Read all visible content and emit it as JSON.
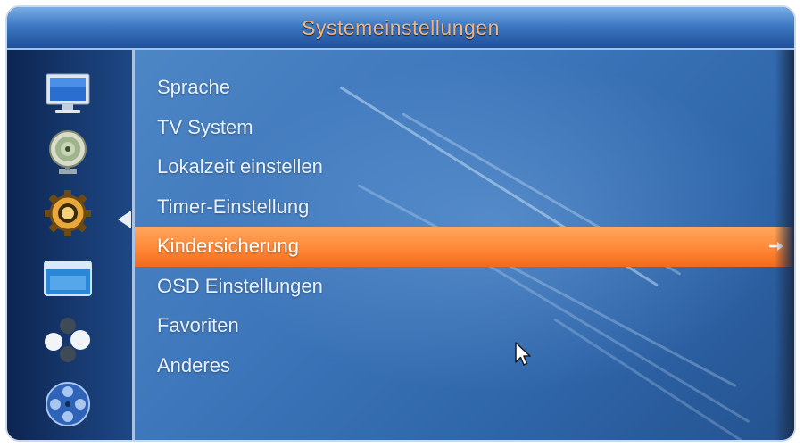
{
  "window": {
    "title": "Systemeinstellungen"
  },
  "sidebar": {
    "icons": [
      {
        "name": "tv-monitor-icon"
      },
      {
        "name": "satellite-dish-icon"
      },
      {
        "name": "gear-icon",
        "selected": true
      },
      {
        "name": "window-icon"
      },
      {
        "name": "balls-icon"
      },
      {
        "name": "film-reel-icon"
      }
    ]
  },
  "menu": {
    "items": [
      {
        "label": "Sprache"
      },
      {
        "label": "TV System"
      },
      {
        "label": "Lokalzeit einstellen"
      },
      {
        "label": "Timer-Einstellung"
      },
      {
        "label": "Kindersicherung",
        "selected": true
      },
      {
        "label": "OSD Einstellungen"
      },
      {
        "label": "Favoriten"
      },
      {
        "label": "Anderes"
      }
    ]
  },
  "colors": {
    "title_text": "#f4b37a",
    "highlight": "#ff8b3a",
    "background": "#3f78bc"
  }
}
